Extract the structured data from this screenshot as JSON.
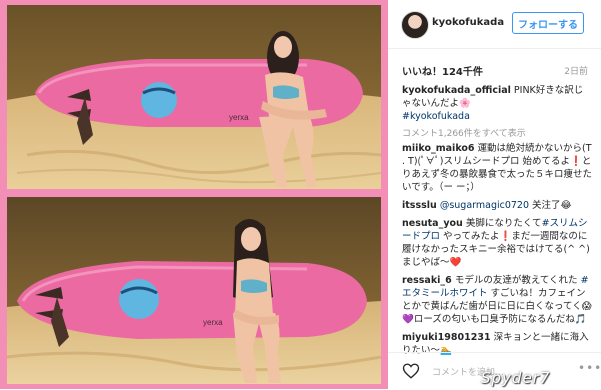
{
  "header": {
    "username": "kyokofukada",
    "follow_label": "フォローする"
  },
  "post": {
    "likes": "いいね！124千件",
    "date": "2日前",
    "caption_user": "kyokofukada_official",
    "caption_text": " PINK好きな訳じゃないんだよ🌸",
    "caption_tag": "#kyokofukada",
    "view_all": "コメント1,266件をすべて表示"
  },
  "comments": [
    {
      "user": "miiko_maiko6",
      "text": " 運動は絶対続かないから(T . T)(ﾟ∀ﾟ)スリムシードプロ 始めてるよ❗️とりあえず冬の暴飲暴食で太った５キロ痩せたいです。（ー ー；）"
    },
    {
      "user": "itssslu",
      "mention": "@sugarmagic0720",
      "text": " 关注了😂"
    },
    {
      "user": "nesuta_you",
      "pre": " 美脚になりたくて",
      "tag": "#スリムシードプロ",
      "text": " やってみたよ❗️まだ一週間なのに履けなかったスキニー余裕ではけてる(^ ^)まじやば〜❤️"
    },
    {
      "user": "ressaki_6",
      "pre": " モデルの友達が教えてくれた ",
      "tag": "#エタミールホワイト",
      "text": " すごいね！カフェインとかで黄ばんだ歯が日に日に白くなってく😱💜ローズの匂いも口臭予防になるんだね🎵"
    },
    {
      "user": "miyuki19801231",
      "text": " 深キョンと一緒に海入りたい〜🏊"
    }
  ],
  "footer": {
    "comment_placeholder": "コメントを追加...",
    "more_icon": "•••"
  },
  "watermark": "Spyder7",
  "colors": {
    "frame": "#f38fb6",
    "accent": "#3897f0",
    "board": "#ec6aa2"
  }
}
